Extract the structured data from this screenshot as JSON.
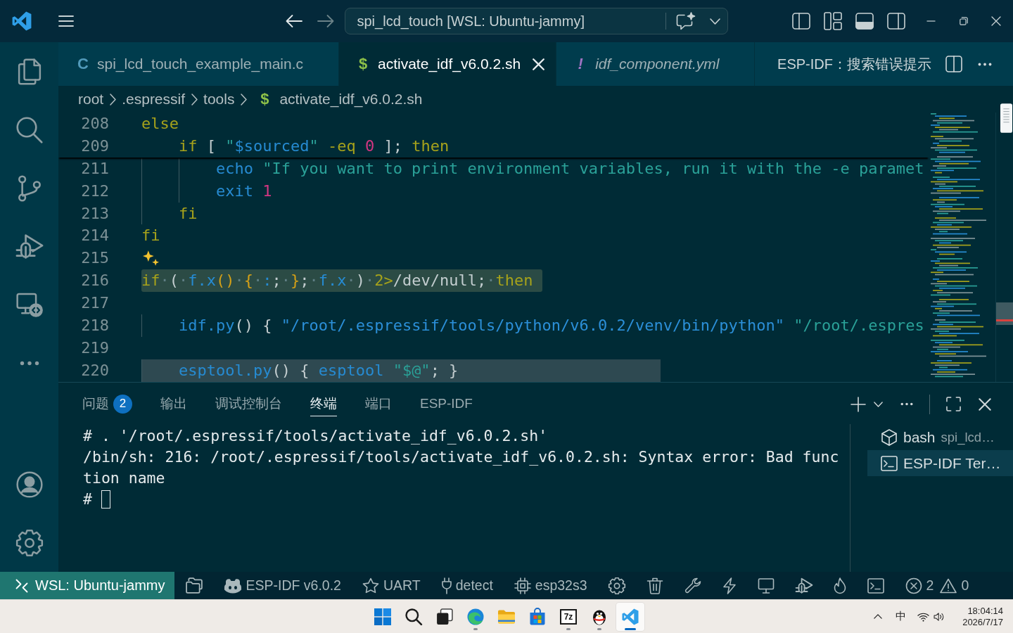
{
  "title_bar": {
    "navigation": {
      "back_disabled": false,
      "forward_disabled": true
    },
    "command_center": "spi_lcd_touch [WSL: Ubuntu-jammy]",
    "layout": {
      "primary_sidebar_on": false,
      "panel_on": true,
      "secondary_sidebar_on": false
    }
  },
  "tabs": [
    {
      "label": "spi_lcd_touch_example_main.c",
      "icon": "C",
      "color": "#519aba",
      "selected": false,
      "preview": false
    },
    {
      "label": "activate_idf_v6.0.2.sh",
      "icon": "$",
      "color": "#8dc149",
      "selected": true,
      "preview": false
    },
    {
      "label": "idf_component.yml",
      "icon": "!",
      "color": "#a074c4",
      "selected": false,
      "preview": true
    }
  ],
  "tab_actions": {
    "command": "ESP-IDF：搜索错误提示"
  },
  "breadcrumbs": [
    {
      "label": "root"
    },
    {
      "label": ".espressif"
    },
    {
      "label": "tools"
    },
    {
      "label": "activate_idf_v6.0.2.sh",
      "icon": "$",
      "color": "#8dc149"
    }
  ],
  "editor": {
    "sticky_lines": [
      {
        "number": "208",
        "tokens": [
          {
            "kind": "keyword",
            "text": "else"
          }
        ]
      },
      {
        "number": "209",
        "tokens": [
          {
            "kind": "keyword",
            "text": "    if"
          },
          {
            "kind": "plain",
            "text": " [ "
          },
          {
            "kind": "string",
            "text": "\""
          },
          {
            "kind": "variable",
            "text": "$sourced"
          },
          {
            "kind": "string",
            "text": "\""
          },
          {
            "kind": "keyword",
            "text": " -eq"
          },
          {
            "kind": "number",
            "text": " 0"
          },
          {
            "kind": "plain",
            "text": " ]; "
          },
          {
            "kind": "keyword",
            "text": "then"
          }
        ]
      }
    ],
    "lines": [
      {
        "number": "211",
        "kind": "code",
        "tokens": [
          {
            "kind": "function",
            "text": "        echo"
          },
          {
            "kind": "string",
            "text": " \"If you want to print environment variables, run it with the -e paramet"
          }
        ]
      },
      {
        "number": "212",
        "kind": "code",
        "tokens": [
          {
            "kind": "function",
            "text": "        exit"
          },
          {
            "kind": "number",
            "text": " 1"
          }
        ]
      },
      {
        "number": "213",
        "kind": "code",
        "tokens": [
          {
            "kind": "keyword",
            "text": "    fi"
          }
        ]
      },
      {
        "number": "214",
        "kind": "code",
        "tokens": [
          {
            "kind": "keyword",
            "text": "fi"
          }
        ]
      },
      {
        "number": "215",
        "kind": "hint"
      },
      {
        "number": "216",
        "kind": "match",
        "tokens": [
          {
            "kind": "keyword",
            "text": "if"
          },
          {
            "kind": "space",
            "text": "·"
          },
          {
            "kind": "plain",
            "text": "("
          },
          {
            "kind": "space",
            "text": "·"
          },
          {
            "kind": "function",
            "text": "f.x"
          },
          {
            "kind": "bracket",
            "text": "()"
          },
          {
            "kind": "space",
            "text": "·"
          },
          {
            "kind": "bracket",
            "text": "{"
          },
          {
            "kind": "space",
            "text": "·"
          },
          {
            "kind": "function",
            "text": ":"
          },
          {
            "kind": "plain",
            "text": ";"
          },
          {
            "kind": "space",
            "text": "·"
          },
          {
            "kind": "bracket",
            "text": "}"
          },
          {
            "kind": "plain",
            "text": ";"
          },
          {
            "kind": "space",
            "text": "·"
          },
          {
            "kind": "function",
            "text": "f.x"
          },
          {
            "kind": "space",
            "text": "·"
          },
          {
            "kind": "plain",
            "text": ")"
          },
          {
            "kind": "space",
            "text": "·"
          },
          {
            "kind": "keyword",
            "text": "2>"
          },
          {
            "kind": "plain",
            "text": "/dev/null;"
          },
          {
            "kind": "space",
            "text": "·"
          },
          {
            "kind": "keyword",
            "text": "then"
          }
        ]
      },
      {
        "number": "217",
        "kind": "code"
      },
      {
        "number": "218",
        "kind": "code",
        "tokens": [
          {
            "kind": "function",
            "text": "    idf.py"
          },
          {
            "kind": "plain",
            "text": "() { "
          },
          {
            "kind": "path",
            "text": "\"/root/.espressif/tools/python/v6.0.2/venv/bin/python\""
          },
          {
            "kind": "string",
            "text": " \"/root/.espres"
          }
        ]
      },
      {
        "number": "219",
        "kind": "code"
      },
      {
        "number": "220",
        "kind": "selection",
        "tokens": [
          {
            "kind": "function",
            "text": "    esptool.py"
          },
          {
            "kind": "plain",
            "text": "() { "
          },
          {
            "kind": "function",
            "text": "esptool"
          },
          {
            "kind": "string",
            "text": " \"$@\""
          },
          {
            "kind": "plain",
            "text": "; }"
          }
        ]
      }
    ]
  },
  "panel": {
    "tabs": [
      {
        "label": "问题",
        "badge": "2",
        "selected": false
      },
      {
        "label": "输出",
        "selected": false
      },
      {
        "label": "调试控制台",
        "selected": false
      },
      {
        "label": "终端",
        "selected": true
      },
      {
        "label": "端口",
        "selected": false
      },
      {
        "label": "ESP-IDF",
        "selected": false
      }
    ],
    "terminal": {
      "lines": [
        "# . '/root/.espressif/tools/activate_idf_v6.0.2.sh'",
        "/bin/sh: 216: /root/.espressif/tools/activate_idf_v6.0.2.sh: Syntax error: Bad func",
        "tion name"
      ],
      "prompt": "#"
    },
    "terminals": [
      {
        "name": "bash",
        "detail": "spi_lcd…",
        "kind": "shell",
        "selected": false
      },
      {
        "name": "ESP-IDF Ter…",
        "kind": "terminal",
        "selected": true
      }
    ]
  },
  "status_bar": {
    "remote": "WSL: Ubuntu-jammy",
    "items": [
      {
        "kind": "project"
      },
      {
        "kind": "version",
        "label": "ESP-IDF v6.0.2"
      },
      {
        "kind": "flash_method",
        "label": "UART"
      },
      {
        "kind": "port",
        "label": "detect"
      },
      {
        "kind": "target",
        "label": "esp32s3"
      },
      {
        "kind": "config"
      },
      {
        "kind": "clean"
      },
      {
        "kind": "build"
      },
      {
        "kind": "flash"
      },
      {
        "kind": "monitor"
      },
      {
        "kind": "debug"
      },
      {
        "kind": "build_flash_monitor"
      },
      {
        "kind": "terminal"
      }
    ],
    "problems": {
      "errors": "2",
      "warnings": "0"
    }
  },
  "taskbar": {
    "apps": [
      {
        "kind": "start",
        "running": false,
        "selected": false
      },
      {
        "kind": "search",
        "running": false,
        "selected": false
      },
      {
        "kind": "task_view",
        "running": false,
        "selected": false
      },
      {
        "kind": "browser",
        "running": true,
        "selected": false
      },
      {
        "kind": "files",
        "running": false,
        "selected": false
      },
      {
        "kind": "store",
        "running": false,
        "selected": false
      },
      {
        "kind": "archiver",
        "text": "7z",
        "running": true,
        "selected": false
      },
      {
        "kind": "messenger",
        "running": true,
        "selected": false
      },
      {
        "kind": "code_editor",
        "running": true,
        "selected": true
      }
    ],
    "tray": {
      "input_method": "中",
      "time": "18:04:14",
      "date": "2026/7/17"
    }
  }
}
